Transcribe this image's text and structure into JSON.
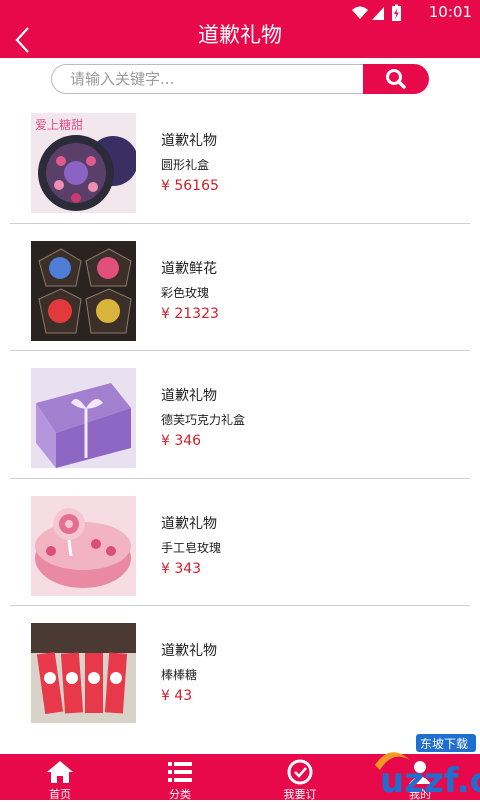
{
  "status_bar": {
    "time": "10:01"
  },
  "header": {
    "title": "道歉礼物"
  },
  "search": {
    "placeholder": "请输入关键字..."
  },
  "products": [
    {
      "name": "道歉礼物",
      "sub": "圆形礼盒",
      "price": "¥ 56165",
      "thumb_text": "爱上糖甜"
    },
    {
      "name": "道歉鲜花",
      "sub": "彩色玫瑰",
      "price": "¥ 21323"
    },
    {
      "name": "道歉礼物",
      "sub": "德芙巧克力礼盒",
      "price": "¥ 346"
    },
    {
      "name": "道歉礼物",
      "sub": "手工皂玫瑰",
      "price": "¥ 343"
    },
    {
      "name": "道歉礼物",
      "sub": "棒棒糖",
      "price": "¥ 43"
    }
  ],
  "tabbar": [
    {
      "label": "首页",
      "icon": "home-icon"
    },
    {
      "label": "分类",
      "icon": "list-icon"
    },
    {
      "label": "我要订",
      "icon": "order-icon"
    },
    {
      "label": "我的",
      "icon": "user-icon"
    }
  ],
  "watermark": {
    "text": "uzzf.com",
    "badge": "东坡下载"
  },
  "colors": {
    "accent": "#e8094a",
    "price": "#d0202b",
    "divider": "#cfcfcf"
  }
}
